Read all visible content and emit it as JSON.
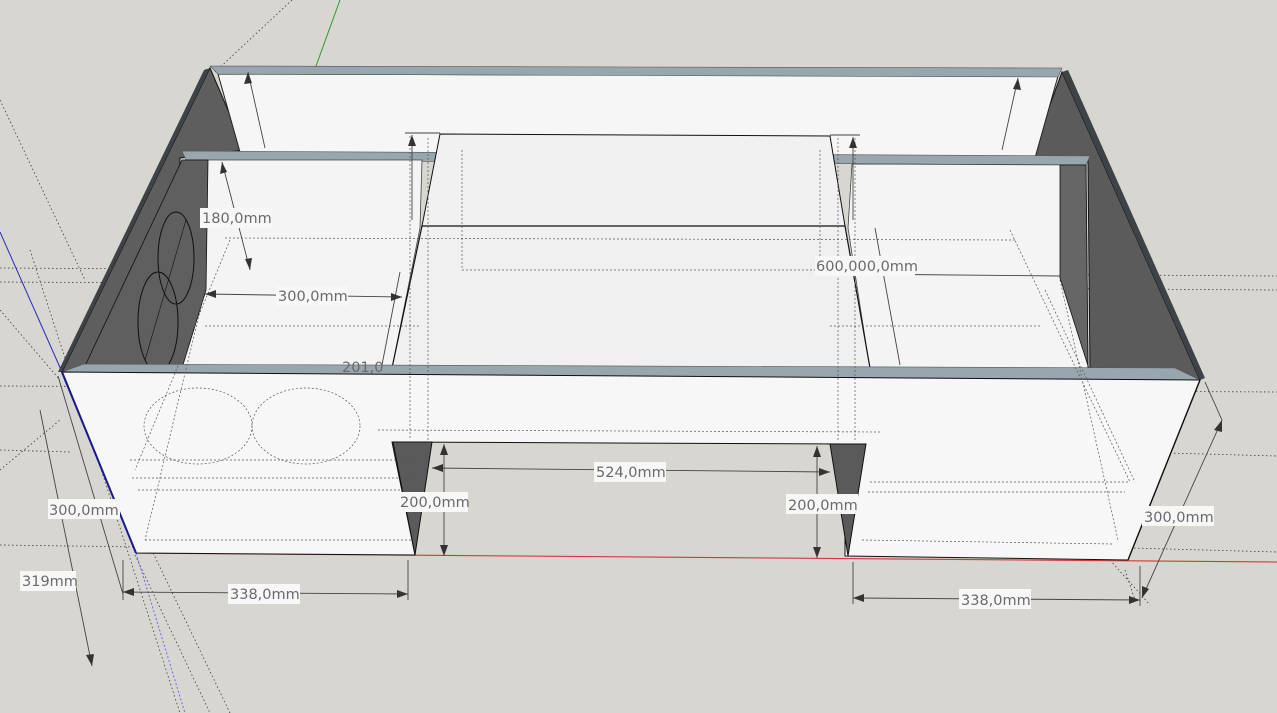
{
  "app": "SketchUp",
  "colors": {
    "background": "#d7d6d1",
    "panel_face": "#f5f5f5",
    "panel_edge": "#9aa7ae",
    "panel_side": "#5f5f5f",
    "axis_red": "#d23a3a",
    "axis_green": "#2a9a2a",
    "axis_blue": "#2a2ac0"
  },
  "dimensions": {
    "d_180": "180,0mm",
    "d_300_inner": "300,0mm",
    "d_600_overlap": "600,000,0mm",
    "d_201": "201,0",
    "d_524": "524,0mm",
    "d_200_left": "200,0mm",
    "d_200_right": "200,0mm",
    "d_300_left": "300,0mm",
    "d_300_right": "300,0mm",
    "d_319": "319mm",
    "d_338_left": "338,0mm",
    "d_338_right": "338,0mm"
  }
}
